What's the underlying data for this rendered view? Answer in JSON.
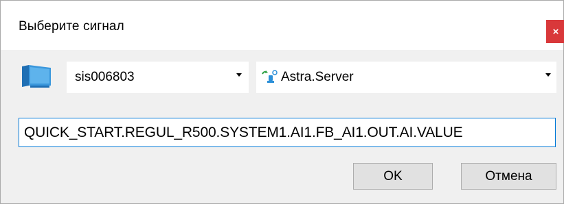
{
  "dialog": {
    "title": "Выберите сигнал",
    "close_label": "×"
  },
  "host_combo": {
    "value": "sis006803",
    "icon": "computer-icon"
  },
  "server_combo": {
    "value": "Astra.Server",
    "icon": "server-icon"
  },
  "signal_path": {
    "value": "QUICK_START.REGUL_R500.SYSTEM1.AI1.FB_AI1.OUT.AI.VALUE"
  },
  "buttons": {
    "ok_label": "OK",
    "cancel_label": "Отмена"
  },
  "colors": {
    "close_button": "#d9383a",
    "body_background": "#f0f0f0",
    "focus_border": "#0078d7",
    "icon_blue": "#2a8fd8"
  }
}
